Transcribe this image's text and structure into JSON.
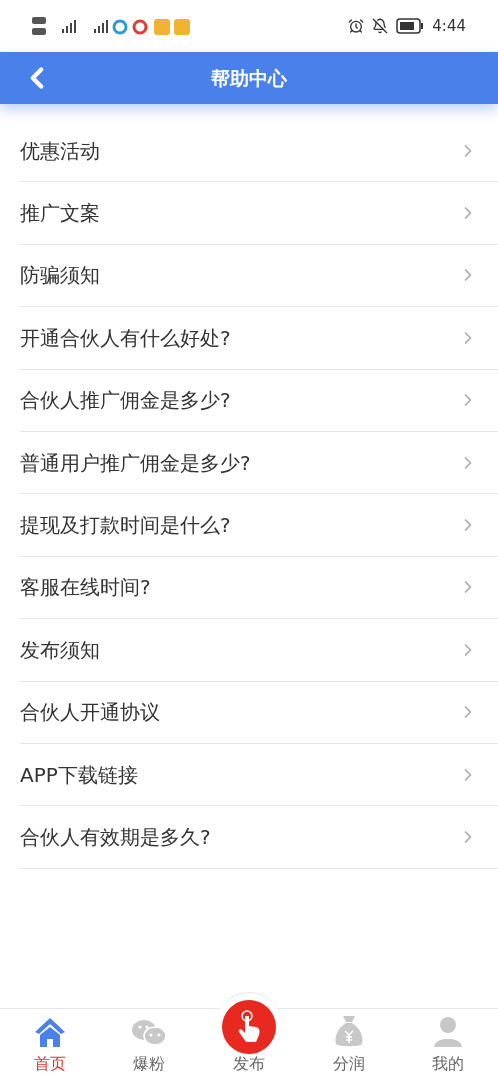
{
  "status_bar": {
    "time": "4:44"
  },
  "header": {
    "title": "帮助中心"
  },
  "items": [
    {
      "label": "优惠活动"
    },
    {
      "label": "推广文案"
    },
    {
      "label": "防骗须知"
    },
    {
      "label": "开通合伙人有什么好处?"
    },
    {
      "label": "合伙人推广佣金是多少?"
    },
    {
      "label": "普通用户推广佣金是多少?"
    },
    {
      "label": "提现及打款时间是什么?"
    },
    {
      "label": "客服在线时间?"
    },
    {
      "label": "发布须知"
    },
    {
      "label": "合伙人开通协议"
    },
    {
      "label": "APP下载链接"
    },
    {
      "label": "合伙人有效期是多久?"
    }
  ],
  "tabs": [
    {
      "label": "首页",
      "kind": "home",
      "selected": true
    },
    {
      "label": "爆粉",
      "kind": "chat",
      "selected": false
    },
    {
      "label": "发布",
      "kind": "publish",
      "selected": false
    },
    {
      "label": "分润",
      "kind": "money",
      "selected": false
    },
    {
      "label": "我的",
      "kind": "user",
      "selected": false
    }
  ]
}
